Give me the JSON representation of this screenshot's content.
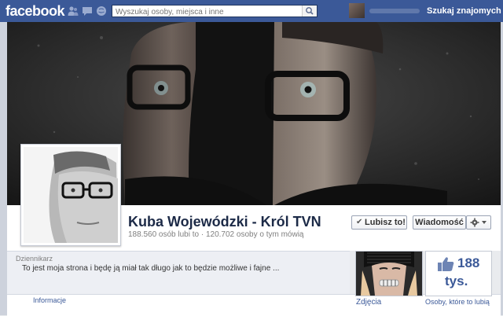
{
  "topbar": {
    "logo": "facebook",
    "search_placeholder": "Wyszukaj osoby, miejsca i inne",
    "find_friends": "Szukaj znajomych"
  },
  "page": {
    "name": "Kuba Wojewódzki - Król TVN",
    "stats": "188.560 osób lubi to · 120.702 osoby o tym mówią",
    "category": "Dziennikarz",
    "about": "To jest moja strona i będę ją miał tak długo jak to będzie możliwe i fajne ..."
  },
  "actions": {
    "like_button": "Lubisz to!",
    "message_button": "Wiadomość"
  },
  "apps": {
    "info": "Informacje",
    "photos": "Zdjęcia",
    "likes_count": "188",
    "likes_unit": "tys.",
    "likes_label": "Osoby, które to lubią"
  },
  "colors": {
    "brand": "#3b5998",
    "background": "#e9ebee"
  }
}
